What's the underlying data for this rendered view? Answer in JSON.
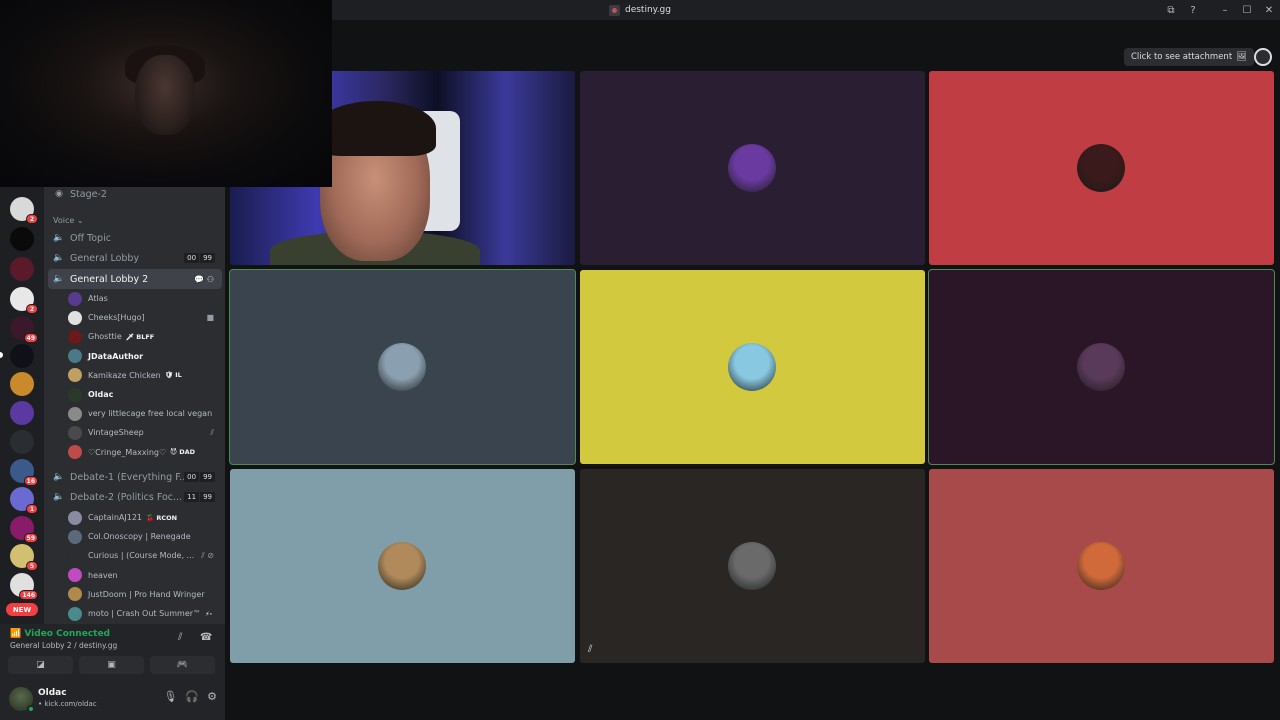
{
  "titlebar": {
    "title": "destiny.gg"
  },
  "servers": [
    {
      "color": "#d9d9d9",
      "badge": "2"
    },
    {
      "color": "#0a0a0a",
      "badge": ""
    },
    {
      "color": "#5a1a2a",
      "badge": ""
    },
    {
      "color": "#e8e8e8",
      "badge": "2"
    },
    {
      "color": "#3a1a2a",
      "badge": "49"
    },
    {
      "color": "#101018",
      "badge": ""
    },
    {
      "color": "#c88a2a",
      "badge": ""
    },
    {
      "color": "#5a3aa0",
      "badge": ""
    },
    {
      "color": "#2a2d31",
      "badge": ""
    },
    {
      "color": "#3a5a8a",
      "badge": "16"
    },
    {
      "color": "#6a6ad0",
      "badge": "1"
    },
    {
      "color": "#8a1a6a",
      "badge": "59"
    },
    {
      "color": "#d0c070",
      "badge": "5"
    },
    {
      "color": "#e0e0e0",
      "badge": "146"
    }
  ],
  "new_label": "NEW",
  "channels": {
    "stage2": "Stage-2",
    "voice_category": "Voice ⌄",
    "off_topic": "Off Topic",
    "general_lobby": "General Lobby",
    "general_lobby_counts": [
      "00",
      "99"
    ],
    "general_lobby_2": "General Lobby 2",
    "debate1": "Debate-1 (Everything F...",
    "debate1_counts": [
      "00",
      "99"
    ],
    "debate2": "Debate-2 (Politics Foc...",
    "debate2_counts": [
      "11",
      "99"
    ]
  },
  "lobby2_users": [
    {
      "name": "Atlas",
      "tag": "",
      "color": "#5a3a8a",
      "bright": false
    },
    {
      "name": "Cheeks[Hugo]",
      "tag": "",
      "color": "#e0e0e0",
      "bright": false
    },
    {
      "name": "Ghosttie",
      "tag": "🗡 BLFF",
      "color": "#6a1a1a",
      "bright": false
    },
    {
      "name": "JDataAuthor",
      "tag": "",
      "color": "#4a7a8a",
      "bright": true
    },
    {
      "name": "Kamikaze Chicken",
      "tag": "🛡 IL",
      "color": "#c0a060",
      "bright": false
    },
    {
      "name": "Oldac",
      "tag": "",
      "color": "#2a3a2a",
      "bright": true
    },
    {
      "name": "very littlecage free local vegan",
      "tag": "",
      "color": "#8a8a8a",
      "bright": false
    },
    {
      "name": "VintageSheep",
      "tag": "",
      "color": "#4a4a4a",
      "bright": false
    },
    {
      "name": "♡Cringe_Maxxing♡",
      "tag": "😈 DAD",
      "color": "#c04a4a",
      "bright": false
    }
  ],
  "debate2_users": [
    {
      "name": "CaptainAJ121",
      "tag": "🍒 RCON",
      "color": "#8a8aa0"
    },
    {
      "name": "Col.Onoscopy | Renegade",
      "tag": "",
      "color": "#5a6a7a"
    },
    {
      "name": "Curious | (Course Mode, ...",
      "tag": "",
      "color": "#2b2d31"
    },
    {
      "name": "heaven",
      "tag": "",
      "color": "#c04ac0"
    },
    {
      "name": "JustDoom | Pro Hand Wringer",
      "tag": "",
      "color": "#b08a4a"
    },
    {
      "name": "moto | Crash Out Summer™",
      "tag": "⚡·",
      "color": "#4a8a8a"
    }
  ],
  "voice_panel": {
    "status": "Video Connected",
    "location": "General Lobby 2 / destiny.gg"
  },
  "user_panel": {
    "name": "Oldac",
    "status": "• kick.com/oldac"
  },
  "attachment": {
    "label": "Click to see attachment"
  },
  "tiles": [
    {
      "type": "camera",
      "bg": "#1a1d4e",
      "avatar": "",
      "speaking": false
    },
    {
      "type": "avatar",
      "bg": "#2a1e33",
      "avatar": "#6a3aa0",
      "speaking": false
    },
    {
      "type": "avatar",
      "bg": "#c13d44",
      "avatar": "#3a1a1a",
      "speaking": false
    },
    {
      "type": "avatar",
      "bg": "#3a444f",
      "avatar": "#8aa0b0",
      "speaking": true
    },
    {
      "type": "avatar",
      "bg": "#d2c93f",
      "avatar": "#88c8e0",
      "speaking": false
    },
    {
      "type": "avatar",
      "bg": "#2a1626",
      "avatar": "#5a3a5a",
      "speaking": true
    },
    {
      "type": "avatar",
      "bg": "#7f9ea9",
      "avatar": "#b08a5a",
      "speaking": false
    },
    {
      "type": "avatar",
      "bg": "#2a2624",
      "avatar": "#6a6a6a",
      "speaking": false,
      "muted": true
    },
    {
      "type": "avatar",
      "bg": "#a84a4a",
      "avatar": "#d06a3a",
      "speaking": false
    }
  ]
}
